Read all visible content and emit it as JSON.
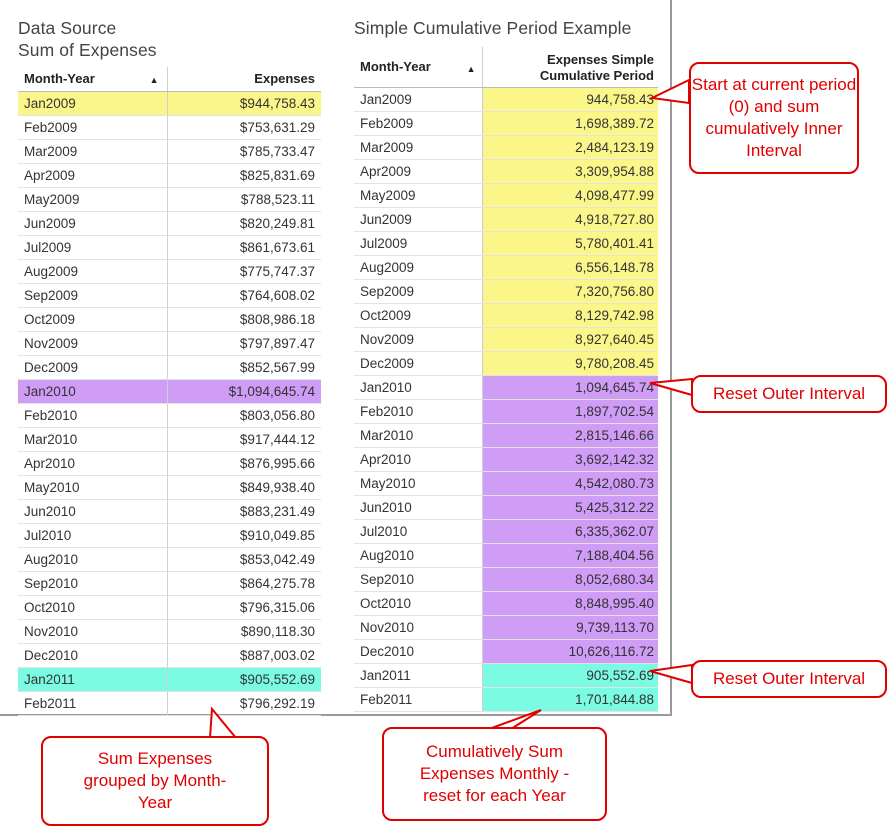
{
  "left": {
    "title_line1": "Data Source",
    "title_line2": "Sum of Expenses",
    "columns": [
      "Month-Year",
      "Expenses"
    ],
    "rows": [
      [
        "Jan2009",
        "$944,758.43"
      ],
      [
        "Feb2009",
        "$753,631.29"
      ],
      [
        "Mar2009",
        "$785,733.47"
      ],
      [
        "Apr2009",
        "$825,831.69"
      ],
      [
        "May2009",
        "$788,523.11"
      ],
      [
        "Jun2009",
        "$820,249.81"
      ],
      [
        "Jul2009",
        "$861,673.61"
      ],
      [
        "Aug2009",
        "$775,747.37"
      ],
      [
        "Sep2009",
        "$764,608.02"
      ],
      [
        "Oct2009",
        "$808,986.18"
      ],
      [
        "Nov2009",
        "$797,897.47"
      ],
      [
        "Dec2009",
        "$852,567.99"
      ],
      [
        "Jan2010",
        "$1,094,645.74"
      ],
      [
        "Feb2010",
        "$803,056.80"
      ],
      [
        "Mar2010",
        "$917,444.12"
      ],
      [
        "Apr2010",
        "$876,995.66"
      ],
      [
        "May2010",
        "$849,938.40"
      ],
      [
        "Jun2010",
        "$883,231.49"
      ],
      [
        "Jul2010",
        "$910,049.85"
      ],
      [
        "Aug2010",
        "$853,042.49"
      ],
      [
        "Sep2010",
        "$864,275.78"
      ],
      [
        "Oct2010",
        "$796,315.06"
      ],
      [
        "Nov2010",
        "$890,118.30"
      ],
      [
        "Dec2010",
        "$887,003.02"
      ],
      [
        "Jan2011",
        "$905,552.69"
      ],
      [
        "Feb2011",
        "$796,292.19"
      ]
    ]
  },
  "right": {
    "title": "Simple Cumulative Period Example",
    "col1": "Month-Year",
    "col2_line1": "Expenses Simple",
    "col2_line2": "Cumulative Period",
    "rows": [
      [
        "Jan2009",
        "944,758.43"
      ],
      [
        "Feb2009",
        "1,698,389.72"
      ],
      [
        "Mar2009",
        "2,484,123.19"
      ],
      [
        "Apr2009",
        "3,309,954.88"
      ],
      [
        "May2009",
        "4,098,477.99"
      ],
      [
        "Jun2009",
        "4,918,727.80"
      ],
      [
        "Jul2009",
        "5,780,401.41"
      ],
      [
        "Aug2009",
        "6,556,148.78"
      ],
      [
        "Sep2009",
        "7,320,756.80"
      ],
      [
        "Oct2009",
        "8,129,742.98"
      ],
      [
        "Nov2009",
        "8,927,640.45"
      ],
      [
        "Dec2009",
        "9,780,208.45"
      ],
      [
        "Jan2010",
        "1,094,645.74"
      ],
      [
        "Feb2010",
        "1,897,702.54"
      ],
      [
        "Mar2010",
        "2,815,146.66"
      ],
      [
        "Apr2010",
        "3,692,142.32"
      ],
      [
        "May2010",
        "4,542,080.73"
      ],
      [
        "Jun2010",
        "5,425,312.22"
      ],
      [
        "Jul2010",
        "6,335,362.07"
      ],
      [
        "Aug2010",
        "7,188,404.56"
      ],
      [
        "Sep2010",
        "8,052,680.34"
      ],
      [
        "Oct2010",
        "8,848,995.40"
      ],
      [
        "Nov2010",
        "9,739,113.70"
      ],
      [
        "Dec2010",
        "10,626,116.72"
      ],
      [
        "Jan2011",
        "905,552.69"
      ],
      [
        "Feb2011",
        "1,701,844.88"
      ]
    ]
  },
  "callouts": {
    "start": "Start at current period (0) and sum cumulatively Inner Interval",
    "reset1": "Reset Outer Interval",
    "reset2": "Reset Outer Interval",
    "sum_grouped": "Sum Expenses grouped by Month-Year",
    "cumulative": "Cumulatively Sum Expenses Monthly - reset for each Year"
  },
  "icons": {
    "sort": "sort-ascending-icon"
  },
  "colors": {
    "yellow": "#fbf68a",
    "purple": "#cf9cf6",
    "cyan": "#7afbe2",
    "callout_red": "#e00000"
  }
}
